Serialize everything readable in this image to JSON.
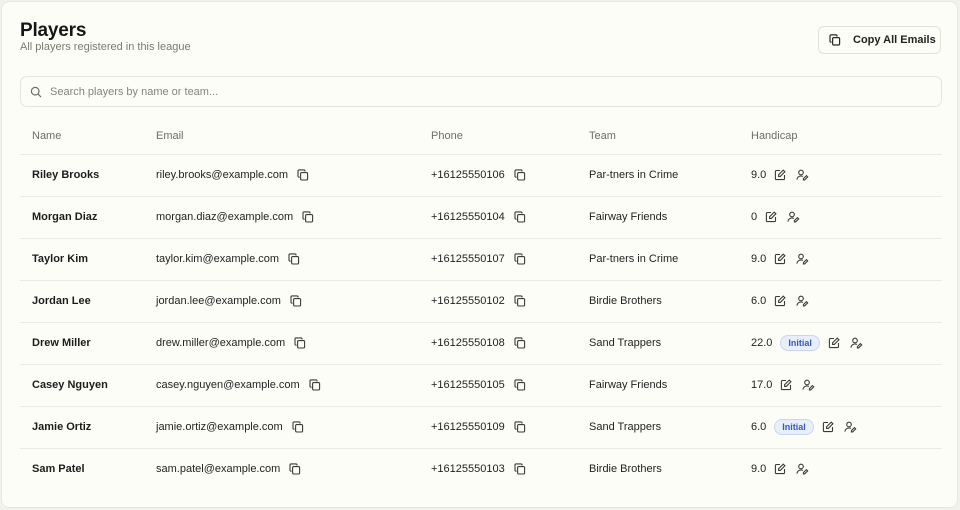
{
  "header": {
    "title": "Players",
    "subtitle": "All players registered in this league",
    "copy_all_label": "Copy All Emails"
  },
  "search": {
    "placeholder": "Search players by name or team...",
    "value": ""
  },
  "table": {
    "columns": [
      "Name",
      "Email",
      "Phone",
      "Team",
      "Handicap"
    ],
    "rows": [
      {
        "name": "Riley Brooks",
        "email": "riley.brooks@example.com",
        "phone": "+16125550106",
        "team": "Par-tners in Crime",
        "handicap": "9.0",
        "badge": ""
      },
      {
        "name": "Morgan Diaz",
        "email": "morgan.diaz@example.com",
        "phone": "+16125550104",
        "team": "Fairway Friends",
        "handicap": "0",
        "badge": ""
      },
      {
        "name": "Taylor Kim",
        "email": "taylor.kim@example.com",
        "phone": "+16125550107",
        "team": "Par-tners in Crime",
        "handicap": "9.0",
        "badge": ""
      },
      {
        "name": "Jordan Lee",
        "email": "jordan.lee@example.com",
        "phone": "+16125550102",
        "team": "Birdie Brothers",
        "handicap": "6.0",
        "badge": ""
      },
      {
        "name": "Drew Miller",
        "email": "drew.miller@example.com",
        "phone": "+16125550108",
        "team": "Sand Trappers",
        "handicap": "22.0",
        "badge": "Initial"
      },
      {
        "name": "Casey Nguyen",
        "email": "casey.nguyen@example.com",
        "phone": "+16125550105",
        "team": "Fairway Friends",
        "handicap": "17.0",
        "badge": ""
      },
      {
        "name": "Jamie Ortiz",
        "email": "jamie.ortiz@example.com",
        "phone": "+16125550109",
        "team": "Sand Trappers",
        "handicap": "6.0",
        "badge": "Initial"
      },
      {
        "name": "Sam Patel",
        "email": "sam.patel@example.com",
        "phone": "+16125550103",
        "team": "Birdie Brothers",
        "handicap": "9.0",
        "badge": ""
      }
    ]
  },
  "icons": {
    "copy": "copy-icon",
    "search": "search-icon",
    "edit": "edit-icon",
    "user_edit": "user-edit-icon"
  },
  "colors": {
    "badge_text": "#3559b8",
    "badge_bg": "#e9eefb"
  }
}
